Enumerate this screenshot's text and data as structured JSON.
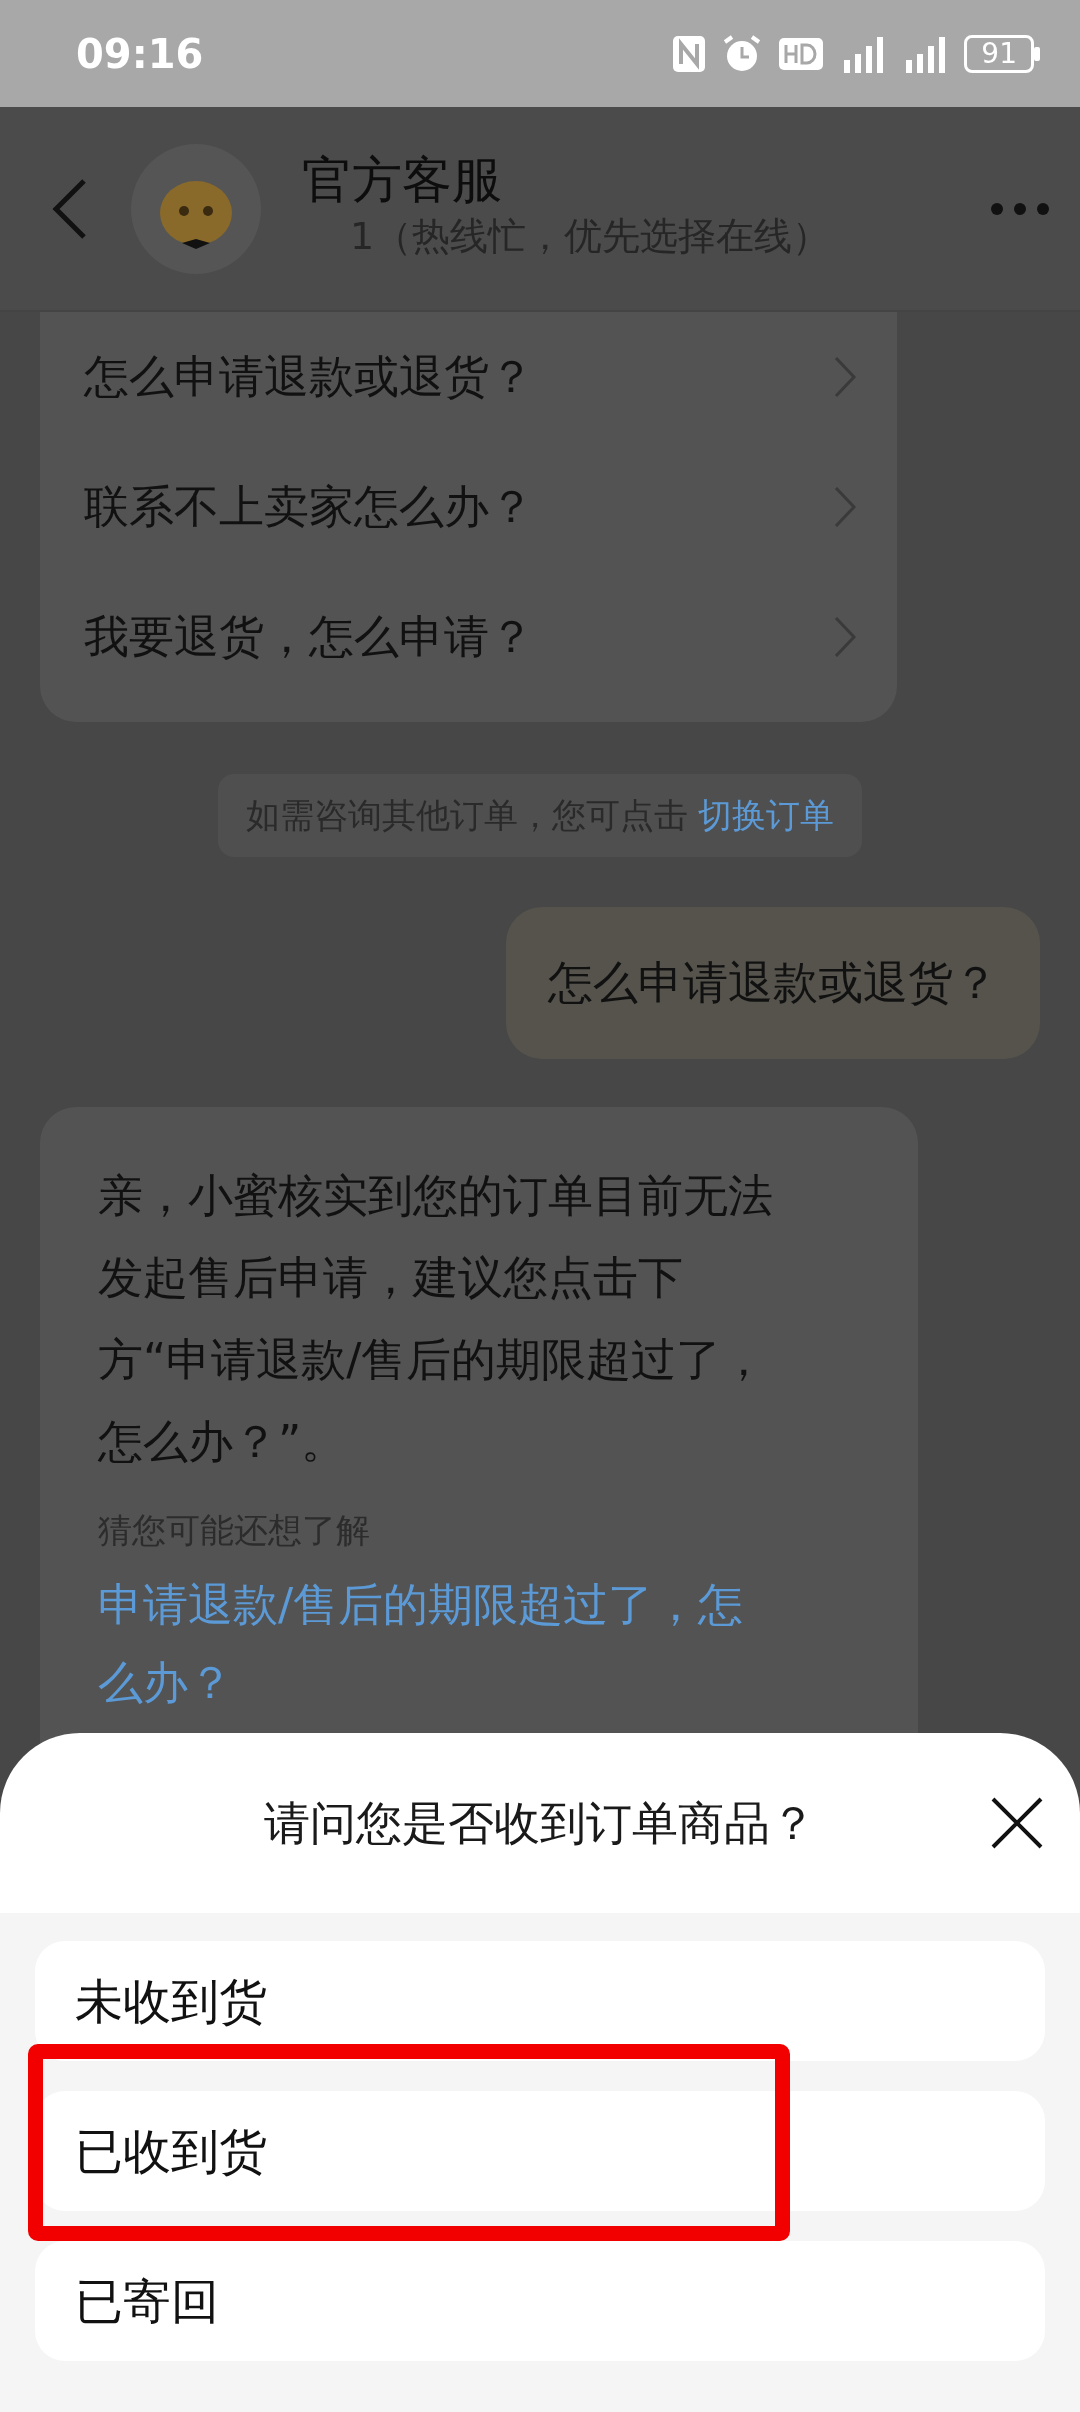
{
  "status_bar": {
    "time": "09:16",
    "battery": "91"
  },
  "header": {
    "title": "官方客服",
    "subtitle": "1（热线忙，优先选择在线）"
  },
  "faq_card": {
    "items": [
      "怎么申请退款或退货？",
      "联系不上卖家怎么办？",
      "我要退货，怎么申请？"
    ]
  },
  "notice": {
    "text": "如需咨询其他订单，您可点击",
    "link": "切换订单"
  },
  "messages": [
    {
      "kind": "user",
      "text": "怎么申请退款或退货？"
    },
    {
      "kind": "bot",
      "text": "亲，小蜜核实到您的订单目前无法发起售后申请，建议您点击下方“申请退款/售后的期限超过了，怎么办？”。",
      "suggest_label": "猜您可能还想了解",
      "suggest_link": "申请退款/售后的期限超过了，怎么办？"
    }
  ],
  "sheet": {
    "title": "请问您是否收到订单商品？",
    "options": [
      {
        "label": "未收到货",
        "highlighted": false
      },
      {
        "label": "已收到货",
        "highlighted": true
      },
      {
        "label": "已寄回",
        "highlighted": false
      }
    ]
  }
}
